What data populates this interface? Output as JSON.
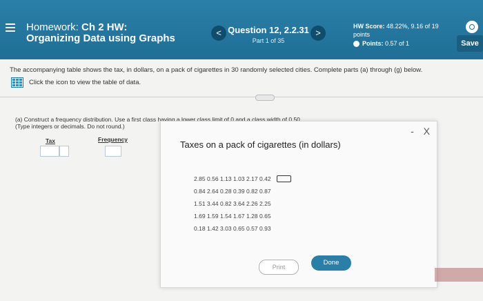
{
  "header": {
    "homework_label": "Homework:",
    "homework_name": "Ch 2 HW:",
    "homework_subtitle": "Organizing Data using Graphs",
    "question_title": "Question 12, 2.2.31",
    "question_part": "Part 1 of 35",
    "prev_icon": "<",
    "next_icon": ">",
    "score_label": "HW Score:",
    "score_value": "48.22%, 9.16 of 19",
    "score_unit": "points",
    "points_label": "Points:",
    "points_value": "0.57 of 1",
    "save_label": "Save"
  },
  "content": {
    "prompt": "The accompanying table shows the tax, in dollars, on a pack of cigarettes in 30 randomly selected cities. Complete parts (a) through (g) below.",
    "view_table_text": "Click the icon to view the table of data.",
    "part_a_line1": "(a) Construct a frequency distribution. Use a first class having a lower class limit of 0 and a class width of 0.50.",
    "part_a_line2": "(Type integers or decimals. Do not round.)",
    "col_tax": "Tax",
    "col_frequency": "Frequency"
  },
  "modal": {
    "title": "Taxes on a pack of cigarettes (in dollars)",
    "minimize": "-",
    "close": "X",
    "rows": [
      [
        "2.85",
        "0.56",
        "1.13",
        "1.03",
        "2.17",
        "0.42"
      ],
      [
        "0.84",
        "2.64",
        "0.28",
        "0.39",
        "0.82",
        "0.87"
      ],
      [
        "1.51",
        "3.44",
        "0.82",
        "3.64",
        "2.26",
        "2.25"
      ],
      [
        "1.69",
        "1.59",
        "1.54",
        "1.67",
        "1.28",
        "0.65"
      ],
      [
        "0.18",
        "1.42",
        "3.03",
        "0.65",
        "0.57",
        "0.93"
      ]
    ],
    "print_label": "Print",
    "done_label": "Done"
  },
  "colors": {
    "header": "#2a7fa8",
    "accent": "#1f6f96"
  }
}
